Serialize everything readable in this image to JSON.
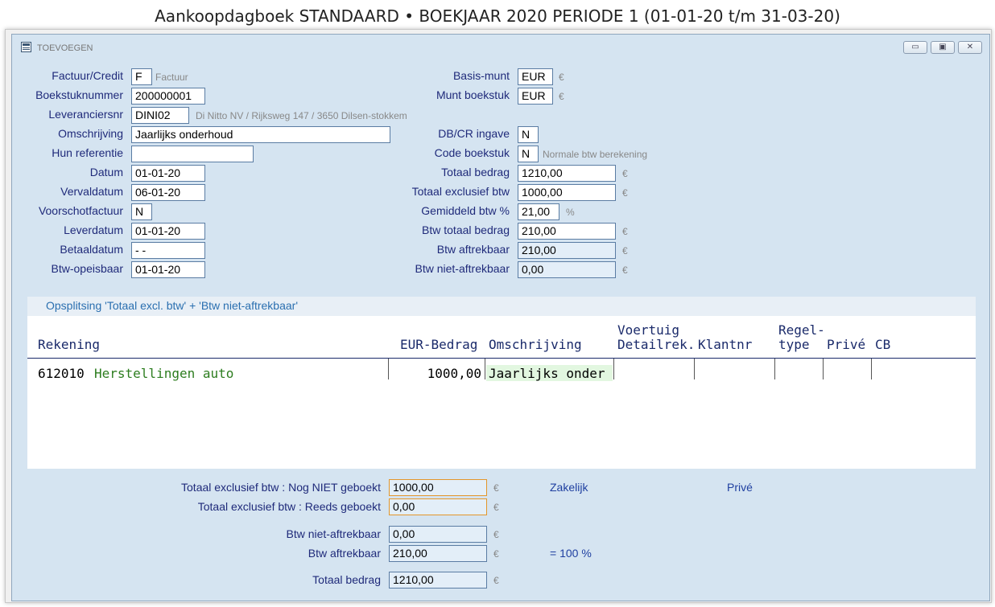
{
  "app_title": "Aankoopdagboek STANDAARD • BOEKJAAR 2020 PERIODE 1 (01-01-20 t/m 31-03-20)",
  "window": {
    "title": "TOEVOEGEN",
    "minimize": "▭",
    "maximize": "▣",
    "close": "✕"
  },
  "left_form": {
    "factuur_credit": {
      "label": "Factuur/Credit",
      "value": "F",
      "hint": "Factuur"
    },
    "boekstuknummer": {
      "label": "Boekstuknummer",
      "value": "200000001"
    },
    "leveranciersnr": {
      "label": "Leveranciersnr",
      "value": "DINI02",
      "hint": "Di Nitto NV / Rijksweg 147 / 3650 Dilsen-stokkem"
    },
    "omschrijving": {
      "label": "Omschrijving",
      "value": "Jaarlijks onderhoud"
    },
    "hun_referentie": {
      "label": "Hun referentie",
      "value": ""
    },
    "datum": {
      "label": "Datum",
      "value": "01-01-20"
    },
    "vervaldatum": {
      "label": "Vervaldatum",
      "value": "06-01-20"
    },
    "voorschotfactuur": {
      "label": "Voorschotfactuur",
      "value": "N"
    },
    "leverdatum": {
      "label": "Leverdatum",
      "value": "01-01-20"
    },
    "betaaldatum": {
      "label": "Betaaldatum",
      "value": "- -"
    },
    "btw_opeisbaar": {
      "label": "Btw-opeisbaar",
      "value": "01-01-20"
    }
  },
  "right_form": {
    "basis_munt": {
      "label": "Basis-munt",
      "value": "EUR",
      "unit": "€"
    },
    "munt_boekstuk": {
      "label": "Munt boekstuk",
      "value": "EUR",
      "unit": "€"
    },
    "dbcr_ingave": {
      "label": "DB/CR ingave",
      "value": "N"
    },
    "code_boekstuk": {
      "label": "Code boekstuk",
      "value": "N",
      "hint": "Normale btw berekening"
    },
    "totaal_bedrag": {
      "label": "Totaal bedrag",
      "value": "1210,00",
      "unit": "€"
    },
    "totaal_excl_btw": {
      "label": "Totaal exclusief btw",
      "value": "1000,00",
      "unit": "€"
    },
    "gemiddeld_btw": {
      "label": "Gemiddeld btw %",
      "value": "21,00",
      "unit": "%"
    },
    "btw_totaal_bedrag": {
      "label": "Btw totaal bedrag",
      "value": "210,00",
      "unit": "€"
    },
    "btw_aftrekbaar": {
      "label": "Btw aftrekbaar",
      "value": "210,00",
      "unit": "€"
    },
    "btw_niet_aftrekbaar": {
      "label": "Btw niet-aftrekbaar",
      "value": "0,00",
      "unit": "€"
    }
  },
  "split": {
    "title": "Opsplitsing 'Totaal excl. btw' + 'Btw niet-aftrekbaar'",
    "headers": {
      "rekening": "Rekening",
      "eur_bedrag": "EUR-Bedrag",
      "omschrijving": "Omschrijving",
      "voertuig_1": "Voertuig",
      "voertuig_2": "Detailrek.",
      "klantnr": "Klantnr",
      "regel_1": "Regel-",
      "regel_2": "type",
      "prive": "Privé",
      "cb": "CB"
    },
    "rows": [
      {
        "rekening_nr": "612010",
        "rekening_naam": "Herstellingen auto",
        "eur_bedrag": "1000,00",
        "omschrijving": "Jaarlijks onder"
      }
    ]
  },
  "totals": {
    "nog_niet_geboekt": {
      "label": "Totaal exclusief btw : Nog NIET geboekt",
      "value": "1000,00",
      "unit": "€"
    },
    "reeds_geboekt": {
      "label": "Totaal exclusief btw : Reeds geboekt",
      "value": "0,00",
      "unit": "€"
    },
    "btw_niet_aftrekbaar": {
      "label": "Btw niet-aftrekbaar",
      "value": "0,00",
      "unit": "€"
    },
    "btw_aftrekbaar": {
      "label": "Btw aftrekbaar",
      "value": "210,00",
      "unit": "€"
    },
    "totaal_bedrag": {
      "label": "Totaal bedrag",
      "value": "1210,00",
      "unit": "€"
    },
    "zakelijk": "Zakelijk",
    "prive": "Privé",
    "percent_note": "= 100 %"
  }
}
